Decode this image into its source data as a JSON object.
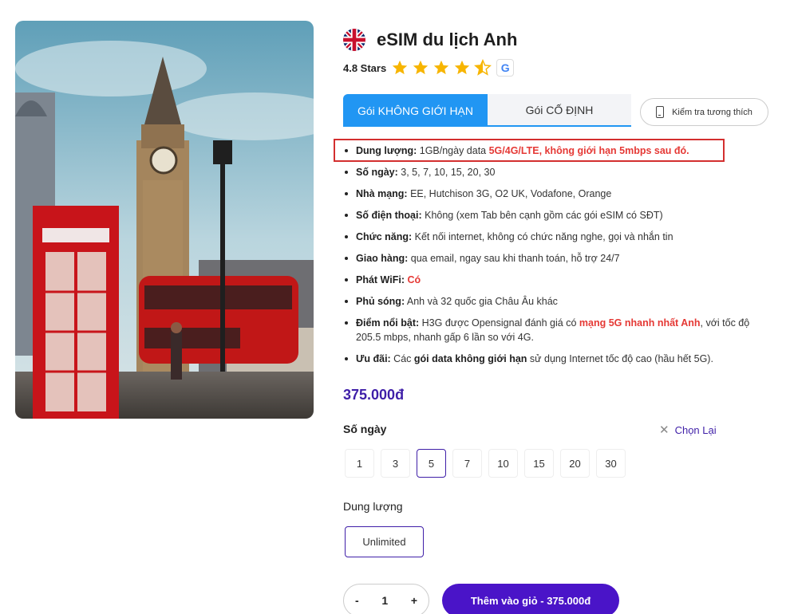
{
  "product": {
    "title": "eSIM du lịch Anh",
    "rating_text": "4.8 Stars",
    "rating_value": 4.5,
    "rating_max": 5,
    "image_icon": "london-big-ben-photo",
    "flag_icon": "uk-flag-icon"
  },
  "tabs": [
    {
      "label": "Gói KHÔNG GIỚI HẠN",
      "active": true
    },
    {
      "label": "Gói CỐ ĐỊNH",
      "active": false
    }
  ],
  "compat_button": "Kiểm tra tương thích",
  "specs": [
    {
      "key": "Dung lượng:",
      "text": " 1GB/ngày data ",
      "red": "5G/4G/LTE, không giới hạn 5mbps sau đó."
    },
    {
      "key": "Số ngày:",
      "text": " 3, 5, 7, 10, 15, 20, 30"
    },
    {
      "key": "Nhà mạng:",
      "text": " EE, Hutchison 3G, O2 UK, Vodafone, Orange"
    },
    {
      "key": "Số điện thoại:",
      "text": " Không (xem Tab bên cạnh gồm các gói eSIM có SĐT)"
    },
    {
      "key": "Chức năng:",
      "text": " Kết nối internet, không có chức năng nghe, gọi và nhắn tin"
    },
    {
      "key": "Giao hàng:",
      "text": " qua email, ngay sau khi thanh toán, hỗ trợ 24/7"
    },
    {
      "key": "Phát WiFi:",
      "text": " ",
      "red": "Có"
    },
    {
      "key": "Phủ sóng:",
      "text": " Anh và 32 quốc gia Châu Âu khác"
    },
    {
      "key": "Điểm nổi bật:",
      "text_a": " H3G được Opensignal đánh giá có ",
      "red": "mạng 5G nhanh nhất Anh",
      "text_b": ", với tốc độ 205.5 mbps, nhanh gấp 6 lần so với 4G."
    },
    {
      "key": "Ưu đãi:",
      "text_a": " Các ",
      "bold": "gói data không giới hạn",
      "text_b": " sử dụng Internet tốc độ cao (hầu hết 5G)."
    }
  ],
  "price": "375.000đ",
  "days_label": "Số ngày",
  "reset_label": "Chọn Lại",
  "days": [
    "1",
    "3",
    "5",
    "7",
    "10",
    "15",
    "20",
    "30"
  ],
  "selected_day": "5",
  "data_label": "Dung lượng",
  "data_option": "Unlimited",
  "quantity": {
    "minus": "-",
    "value": "1",
    "plus": "+"
  },
  "cart_button": "Thêm vào giỏ - 375.000đ",
  "colors": {
    "accent": "#4a14c8",
    "tab_active": "#2196f3",
    "red": "#e53935",
    "star": "#f7b500"
  }
}
